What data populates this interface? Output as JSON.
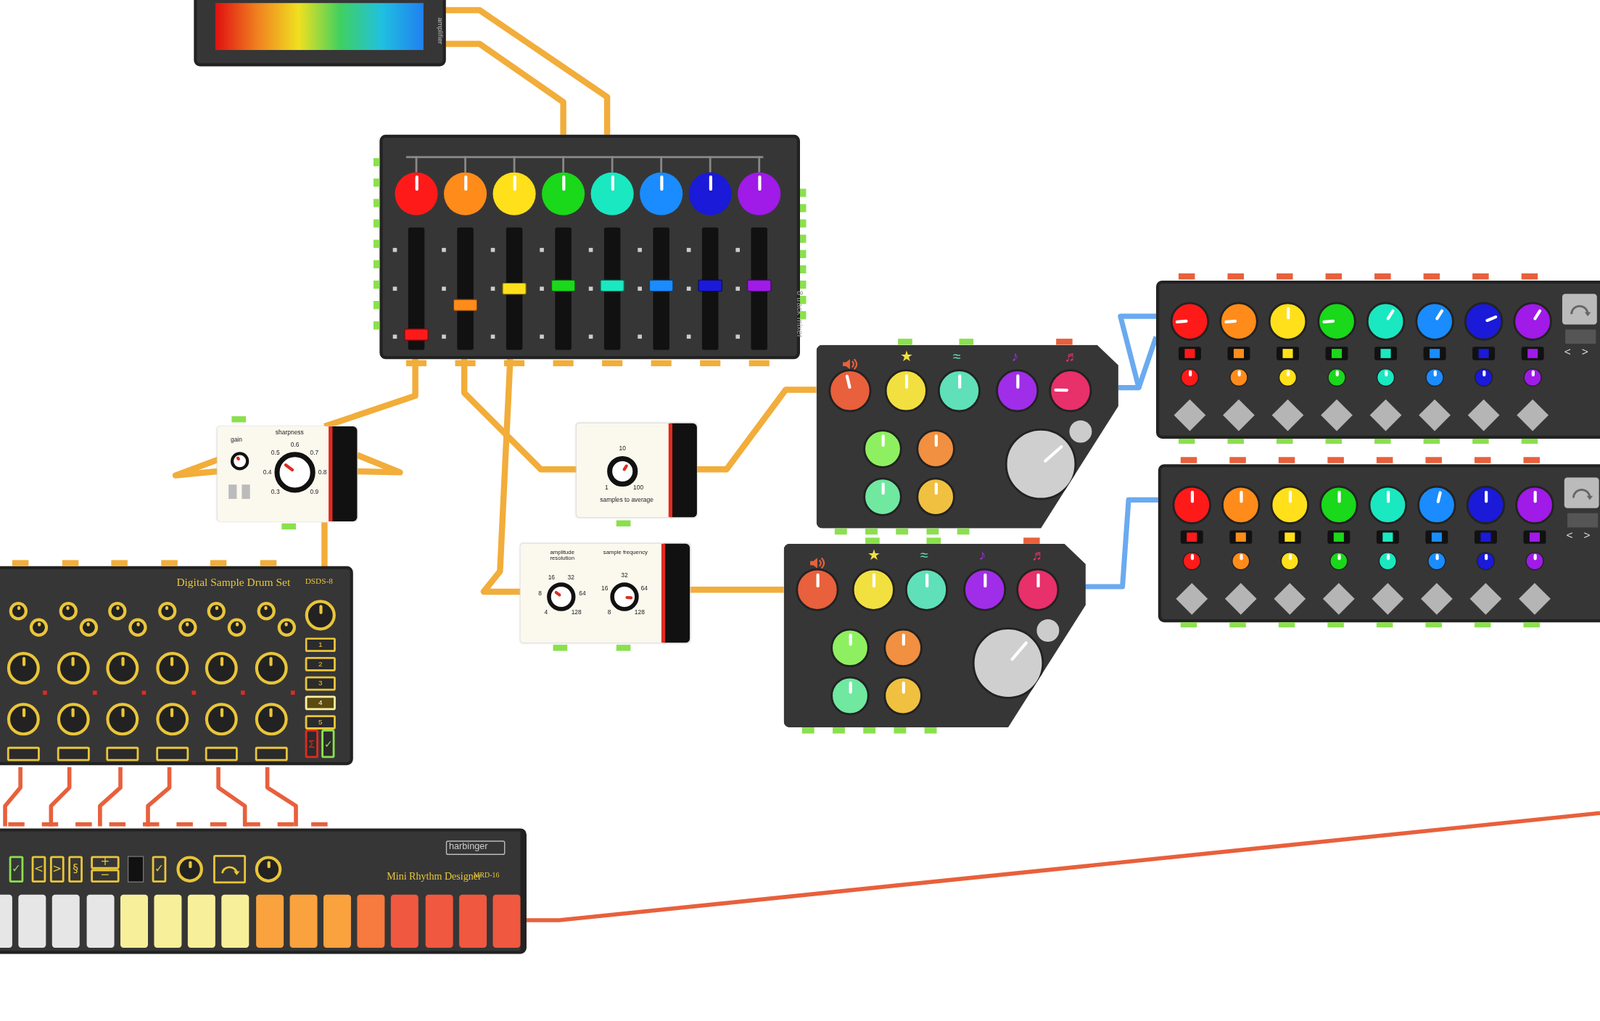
{
  "amplifier": {
    "label": "amplifier"
  },
  "mixer": {
    "label": "8 track mixer",
    "tracks": [
      {
        "color": "#ff1a1a",
        "pan": 0.5,
        "level": 0.08
      },
      {
        "color": "#ff8c1a",
        "pan": 0.5,
        "level": 0.35
      },
      {
        "color": "#ffe01a",
        "pan": 0.5,
        "level": 0.5
      },
      {
        "color": "#1ad81a",
        "pan": 0.5,
        "level": 0.53
      },
      {
        "color": "#1ae8c0",
        "pan": 0.5,
        "level": 0.53
      },
      {
        "color": "#1a8cff",
        "pan": 0.5,
        "level": 0.53
      },
      {
        "color": "#1a1ad8",
        "pan": 0.5,
        "level": 0.53
      },
      {
        "color": "#a01ae8",
        "pan": 0.5,
        "level": 0.53
      }
    ]
  },
  "distortion": {
    "labels": [
      "gain",
      "sharpness"
    ],
    "knobs": [
      {
        "level": 0.35
      },
      {
        "level": 0.3
      }
    ],
    "ticks": [
      "0.3",
      "0.4",
      "0.5",
      "0.6",
      "0.7",
      "0.8",
      "0.9"
    ]
  },
  "moving_average": {
    "label": "samples to average",
    "knob": {
      "level": 0.62
    },
    "ticks": [
      "1",
      "10",
      "100"
    ]
  },
  "bitcrusher": {
    "knobs": [
      {
        "label": "amplitude resolution",
        "level": 0.3,
        "ticks": [
          "4",
          "8",
          "16",
          "32",
          "64",
          "128"
        ]
      },
      {
        "label": "sample frequency",
        "level": 0.85,
        "ticks": [
          "8",
          "16",
          "32",
          "64",
          "128"
        ]
      }
    ]
  },
  "synths": [
    {
      "knobs": [
        {
          "color": "#e8603c",
          "level": 0.45,
          "glyph": ""
        },
        {
          "color": "#f2e040",
          "level": 0.5,
          "glyph": "★"
        },
        {
          "color": "#5fe0b8",
          "level": 0.5,
          "glyph": "≈"
        },
        {
          "color": "#a02de8",
          "level": 0.5,
          "glyph": "♪"
        },
        {
          "color": "#e8306a",
          "level": 0.17,
          "glyph": "♬"
        }
      ],
      "pads": [
        {
          "color": "#8ef060",
          "level": 0.5
        },
        {
          "color": "#f09040",
          "level": 0.5
        },
        {
          "color": "#70e8a0",
          "level": 0.5
        },
        {
          "color": "#f0c040",
          "level": 0.5
        }
      ],
      "big": {
        "level": 0.68
      }
    },
    {
      "knobs": [
        {
          "color": "#e8603c",
          "level": 0.5,
          "glyph": ""
        },
        {
          "color": "#f2e040",
          "level": 0.5,
          "glyph": "★"
        },
        {
          "color": "#5fe0b8",
          "level": 0.5,
          "glyph": "≈"
        },
        {
          "color": "#a02de8",
          "level": 0.5,
          "glyph": "♪"
        },
        {
          "color": "#e8306a",
          "level": 0.5,
          "glyph": "♬"
        }
      ],
      "pads": [
        {
          "color": "#8ef060",
          "level": 0.5
        },
        {
          "color": "#f09040",
          "level": 0.5
        },
        {
          "color": "#70e8a0",
          "level": 0.5
        },
        {
          "color": "#f0c040",
          "level": 0.5
        }
      ],
      "big": {
        "level": 0.65
      }
    }
  ],
  "sequencers": [
    {
      "nav": [
        "<",
        ">"
      ],
      "steps": [
        {
          "color": "#ff1a1a",
          "level": 0.15,
          "on": true,
          "small": 0.5
        },
        {
          "color": "#ff8c1a",
          "level": 0.15,
          "on": true,
          "small": 0.5
        },
        {
          "color": "#ffe01a",
          "level": 0.5,
          "on": true,
          "small": 0.5
        },
        {
          "color": "#1ad81a",
          "level": 0.15,
          "on": true,
          "small": 0.5
        },
        {
          "color": "#1ae8c0",
          "level": 0.62,
          "on": true,
          "small": 0.5
        },
        {
          "color": "#1a8cff",
          "level": 0.62,
          "on": true,
          "small": 0.5
        },
        {
          "color": "#1a1ad8",
          "level": 0.75,
          "on": true,
          "small": 0.5
        },
        {
          "color": "#a01ae8",
          "level": 0.62,
          "on": true,
          "small": 0.5
        }
      ]
    },
    {
      "nav": [
        "<",
        ">"
      ],
      "steps": [
        {
          "color": "#ff1a1a",
          "level": 0.5,
          "on": true,
          "small": 0.5
        },
        {
          "color": "#ff8c1a",
          "level": 0.5,
          "on": true,
          "small": 0.5
        },
        {
          "color": "#ffe01a",
          "level": 0.5,
          "on": true,
          "small": 0.5
        },
        {
          "color": "#1ad81a",
          "level": 0.5,
          "on": true,
          "small": 0.5
        },
        {
          "color": "#1ae8c0",
          "level": 0.5,
          "on": true,
          "small": 0.5
        },
        {
          "color": "#1a8cff",
          "level": 0.55,
          "on": true,
          "small": 0.5
        },
        {
          "color": "#1a1ad8",
          "level": 0.5,
          "on": true,
          "small": 0.5
        },
        {
          "color": "#a01ae8",
          "level": 0.5,
          "on": true,
          "small": 0.5
        }
      ]
    }
  ],
  "drum_set": {
    "title": "Digital Sample Drum Set",
    "model": "DSDS-8",
    "channels": [
      {
        "levels": [
          0.5,
          0.5,
          0.5,
          0.5
        ]
      },
      {
        "levels": [
          0.5,
          0.5,
          0.5,
          0.5
        ]
      },
      {
        "levels": [
          0.5,
          0.5,
          0.5,
          0.5
        ]
      },
      {
        "levels": [
          0.5,
          0.5,
          0.5,
          0.5
        ]
      },
      {
        "levels": [
          0.5,
          0.5,
          0.5,
          0.5
        ]
      },
      {
        "levels": [
          0.5,
          0.5,
          0.5,
          0.5
        ]
      }
    ],
    "master": {
      "level": 0.5
    },
    "selector": [
      {
        "label": "1",
        "selected": false
      },
      {
        "label": "2",
        "selected": false
      },
      {
        "label": "3",
        "selected": false
      },
      {
        "label": "4",
        "selected": true
      },
      {
        "label": "5",
        "selected": false
      }
    ],
    "buttons": [
      "Σ",
      "✓"
    ]
  },
  "rhythm": {
    "brand": "harbinger",
    "title": "Mini Rhythm Designer",
    "model": "MRD-16",
    "controls": [
      "✓",
      "<",
      ">",
      "§",
      "+",
      "−",
      "✓"
    ],
    "knobs": [
      {
        "level": 0.5
      },
      {
        "level": 0.5
      }
    ],
    "keys": [
      {
        "color": "#e6e6e6"
      },
      {
        "color": "#e6e6e6"
      },
      {
        "color": "#e6e6e6"
      },
      {
        "color": "#e6e6e6"
      },
      {
        "color": "#f7ef9a"
      },
      {
        "color": "#f7ef9a"
      },
      {
        "color": "#f7ef9a"
      },
      {
        "color": "#f7ef9a"
      },
      {
        "color": "#f9a23e"
      },
      {
        "color": "#f9a23e"
      },
      {
        "color": "#f9a23e"
      },
      {
        "color": "#f77a3e"
      },
      {
        "color": "#f0583f"
      },
      {
        "color": "#f0583f"
      },
      {
        "color": "#f0583f"
      },
      {
        "color": "#f0583f"
      }
    ]
  },
  "cables": [
    {
      "color": "#f2ad3a"
    },
    {
      "color": "#f2ad3a"
    },
    {
      "color": "#f2ad3a"
    },
    {
      "color": "#f2ad3a"
    },
    {
      "color": "#f2ad3a"
    },
    {
      "color": "#f2ad3a"
    },
    {
      "color": "#f2ad3a"
    },
    {
      "color": "#f2ad3a"
    },
    {
      "color": "#f2ad3a"
    },
    {
      "color": "#f2ad3a"
    },
    {
      "color": "#6aaaf0"
    },
    {
      "color": "#6aaaf0"
    },
    {
      "color": "#6aaaf0"
    },
    {
      "color": "#e8603c"
    },
    {
      "color": "#e8603c"
    },
    {
      "color": "#e8603c"
    },
    {
      "color": "#e8603c"
    },
    {
      "color": "#e8603c"
    },
    {
      "color": "#e8603c"
    },
    {
      "color": "#e8603c"
    }
  ]
}
